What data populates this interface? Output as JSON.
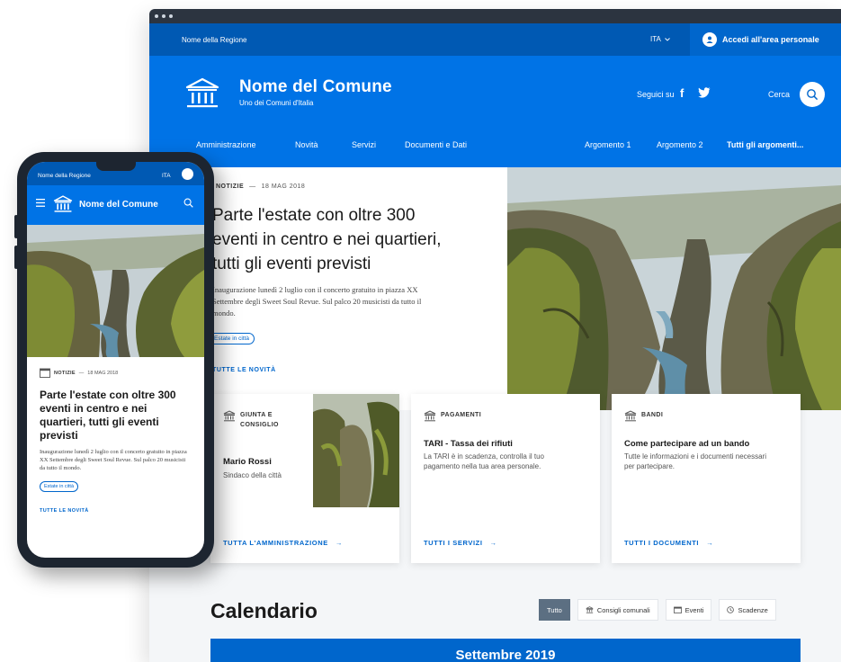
{
  "desktop": {
    "slim_header": {
      "region": "Nome della Regione",
      "language": "ITA",
      "login_label": "Accedi all'area personale"
    },
    "header": {
      "title": "Nome del Comune",
      "tagline": "Uno dei Comuni d'Italia",
      "social_label": "Seguici su",
      "search_label": "Cerca"
    },
    "nav": {
      "primary": [
        "Amministrazione",
        "Novità",
        "Servizi",
        "Documenti e Dati"
      ],
      "topics": [
        "Argomento 1",
        "Argomento 2"
      ],
      "all_topics": "Tutti gli argomenti..."
    },
    "hero": {
      "category": "NOTIZIE",
      "date": "18 MAG 2018",
      "headline": "Parte l'estate con oltre 300 eventi in centro e nei quartieri, tutti gli eventi previsti",
      "text": "Inaugurazione lunedì 2 luglio con il concerto gratuito in piazza XX Settembre degli Sweet Soul Revue. Sul palco 20 musicisti da tutto il mondo.",
      "tag": "Estate in città",
      "all_link": "TUTTE LE NOVITÀ"
    },
    "cards": [
      {
        "category": "GIUNTA E CONSIGLIO",
        "title": "Mario Rossi",
        "text": "Sindaco della città",
        "link": "TUTTA L'AMMINISTRAZIONE"
      },
      {
        "category": "PAGAMENTI",
        "title": "TARI - Tassa dei rifiuti",
        "text": "La TARI è in scadenza, controlla il tuo pagamento nella tua area personale.",
        "link": "TUTTI I SERVIZI"
      },
      {
        "category": "BANDI",
        "title": "Come partecipare ad un bando",
        "text": "Tutte le informazioni e i documenti necessari per partecipare.",
        "link": "TUTTI I DOCUMENTI"
      }
    ],
    "calendar": {
      "title": "Calendario",
      "filters": [
        "Tutto",
        "Consigli comunali",
        "Eventi",
        "Scadenze"
      ],
      "active_filter": "Tutto",
      "month": "Settembre 2019"
    }
  },
  "mobile": {
    "region": "Nome della Regione",
    "language": "ITA",
    "title": "Nome del Comune",
    "category": "NOTIZIE",
    "date": "18 MAG 2018",
    "headline": "Parte l'estate con oltre 300 eventi in centro e nei quartieri, tutti gli eventi previsti",
    "text": "Inaugurazione lunedì 2 luglio con il concerto gratuito in piazza XX Settembre degli Sweet Soul Revue. Sul palco 20 musicisti da tutto il mondo.",
    "tag": "Estate in città",
    "all_link": "TUTTE LE NOVITÀ"
  },
  "colors": {
    "primary": "#0073e6",
    "dark_primary": "#0059b3",
    "link": "#0066cc",
    "filter_active": "#5c6f82"
  }
}
